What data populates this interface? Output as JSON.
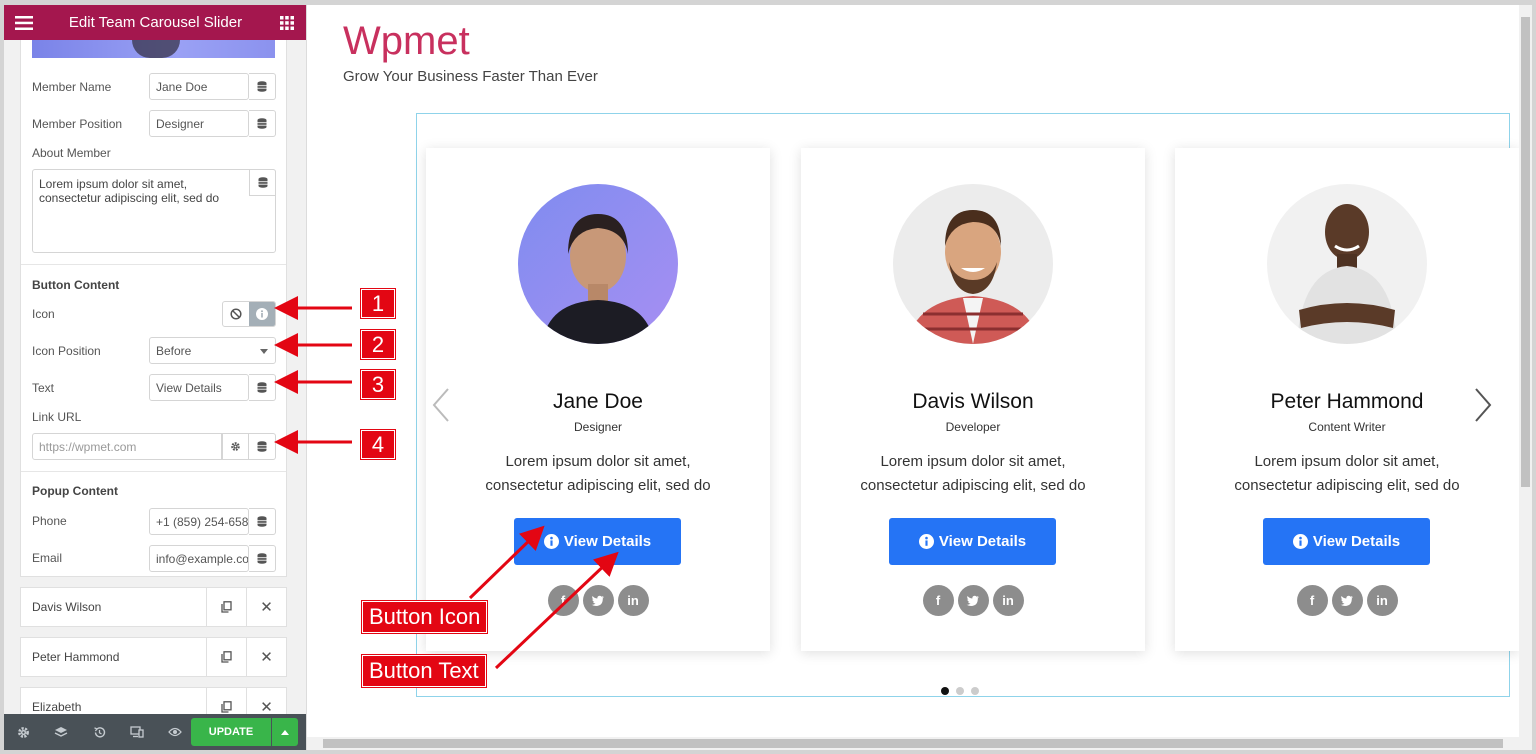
{
  "sidebar": {
    "title": "Edit Team Carousel Slider",
    "fields": {
      "member_name_label": "Member Name",
      "member_name_value": "Jane Doe",
      "member_position_label": "Member Position",
      "member_position_value": "Designer",
      "about_label": "About Member",
      "about_value": "Lorem ipsum dolor sit amet, consectetur adipiscing elit, sed do"
    },
    "button_content": {
      "title": "Button Content",
      "icon_label": "Icon",
      "icon_position_label": "Icon Position",
      "icon_position_value": "Before",
      "text_label": "Text",
      "text_value": "View Details",
      "link_label": "Link URL",
      "link_placeholder": "https://wpmet.com"
    },
    "popup_content": {
      "title": "Popup Content",
      "phone_label": "Phone",
      "phone_value": "+1 (859) 254-658",
      "email_label": "Email",
      "email_value": "info@example.com"
    },
    "repeater_items": [
      {
        "label": "Davis Wilson"
      },
      {
        "label": "Peter Hammond"
      },
      {
        "label": "Elizabeth"
      }
    ],
    "footer": {
      "update_label": "UPDATE"
    }
  },
  "preview": {
    "brand": "Wpmet",
    "tagline": "Grow Your Business Faster Than Ever",
    "cards": [
      {
        "name": "Jane Doe",
        "position": "Designer",
        "description": "Lorem ipsum dolor sit amet, consectetur adipiscing elit, sed do",
        "button": "View Details"
      },
      {
        "name": "Davis Wilson",
        "position": "Developer",
        "description": "Lorem ipsum dolor sit amet, consectetur adipiscing elit, sed do",
        "button": "View Details"
      },
      {
        "name": "Peter Hammond",
        "position": "Content Writer",
        "description": "Lorem ipsum dolor sit amet, consectetur adipiscing elit, sed do",
        "button": "View Details"
      }
    ],
    "pagination": {
      "total": 3,
      "active": 1
    }
  },
  "annotations": {
    "badges": [
      "1",
      "2",
      "3",
      "4"
    ],
    "button_icon": "Button Icon",
    "button_text": "Button Text"
  },
  "colors": {
    "header": "#a4174e",
    "brand": "#c8305e",
    "button": "#2574f5",
    "update": "#39b54a",
    "annotation": "#e30613"
  }
}
